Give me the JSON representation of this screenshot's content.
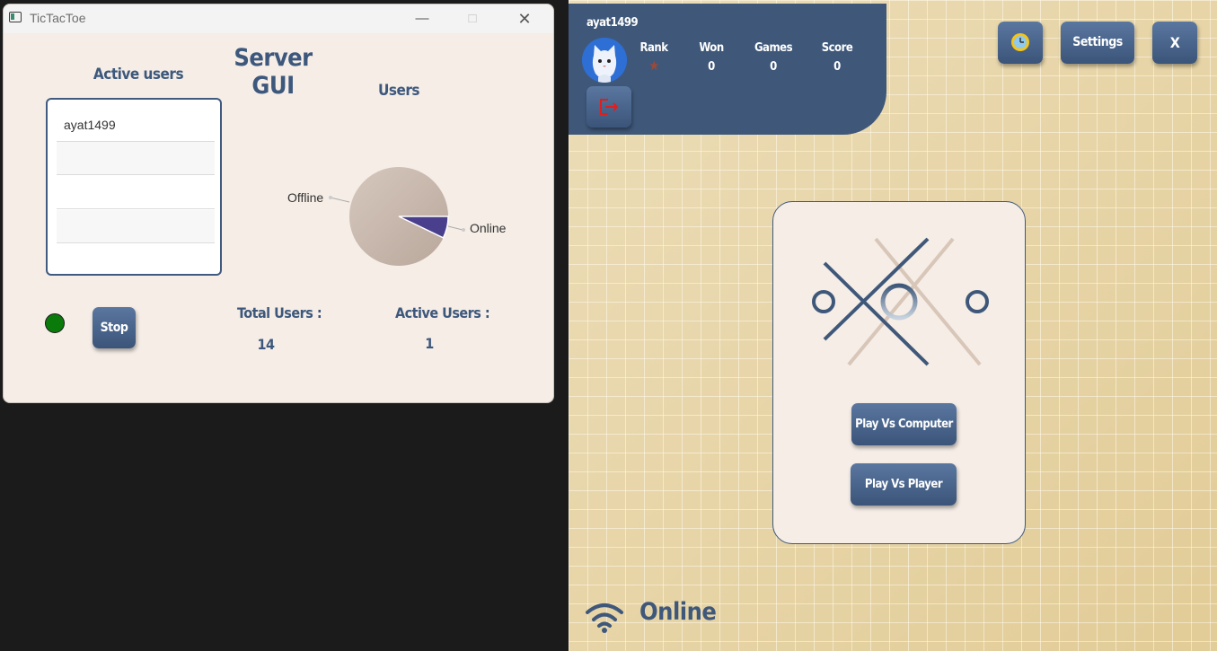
{
  "server_window": {
    "title": "TicTacToe",
    "heading": "Server GUI",
    "active_users_heading": "Active users",
    "active_users": [
      "ayat1499",
      "",
      "",
      "",
      ""
    ],
    "users_chart_heading": "Users",
    "status_color": "#0a7a0a",
    "stop_label": "Stop",
    "total_users_label": "Total Users :",
    "total_users_value": "14",
    "active_users_label": "Active Users :",
    "active_users_value": "1"
  },
  "chart_data": {
    "type": "pie",
    "title": "Users",
    "labels": [
      "Offline",
      "Online"
    ],
    "values": [
      13,
      1
    ],
    "colors": [
      "#c8b8ad",
      "#4a3f8c"
    ]
  },
  "client_window": {
    "username": "ayat1499",
    "stats": {
      "rank_label": "Rank",
      "rank_icon": "star-icon",
      "won_label": "Won",
      "won_value": "0",
      "games_label": "Games",
      "games_value": "0",
      "score_label": "Score",
      "score_value": "0"
    },
    "settings_label": "Settings",
    "exit_label": "X",
    "play_computer_label": "Play Vs Computer",
    "play_player_label": "Play Vs Player",
    "connection_status": "Online",
    "colors": {
      "primary": "#3f587a",
      "card": "#f5ede6",
      "background": "#e6d2a0"
    }
  }
}
